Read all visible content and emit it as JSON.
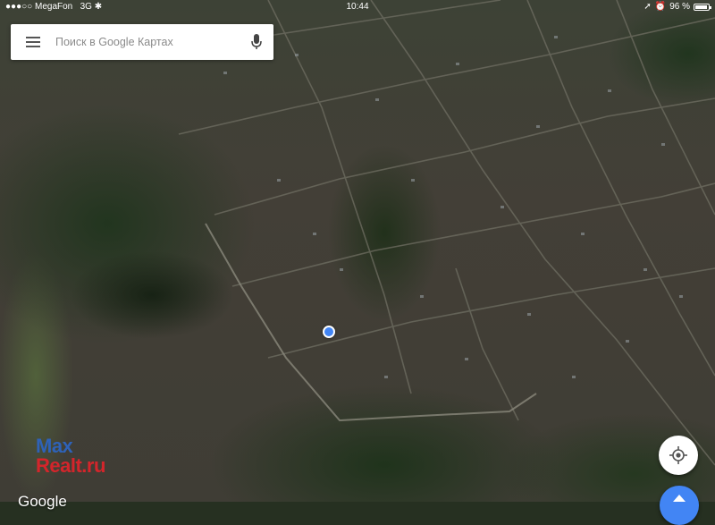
{
  "status_bar": {
    "signal": "●●●○○",
    "carrier": "MegaFon",
    "network": "3G",
    "time": "10:44",
    "battery_percent": "96 %",
    "battery_level": 0.96
  },
  "search": {
    "placeholder": "Поиск в Google Картах",
    "menu_icon": "hamburger-menu-icon",
    "mic_icon": "microphone-icon"
  },
  "map": {
    "type": "satellite",
    "attribution": "Google"
  },
  "controls": {
    "locate_icon": "my-location-icon",
    "directions_icon": "directions-arrow-icon"
  },
  "watermark": {
    "line1": "Max",
    "line2": "Realt.ru"
  },
  "colors": {
    "accent": "#4285f4",
    "watermark_blue": "#2e62b8",
    "watermark_red": "#d4252b"
  }
}
